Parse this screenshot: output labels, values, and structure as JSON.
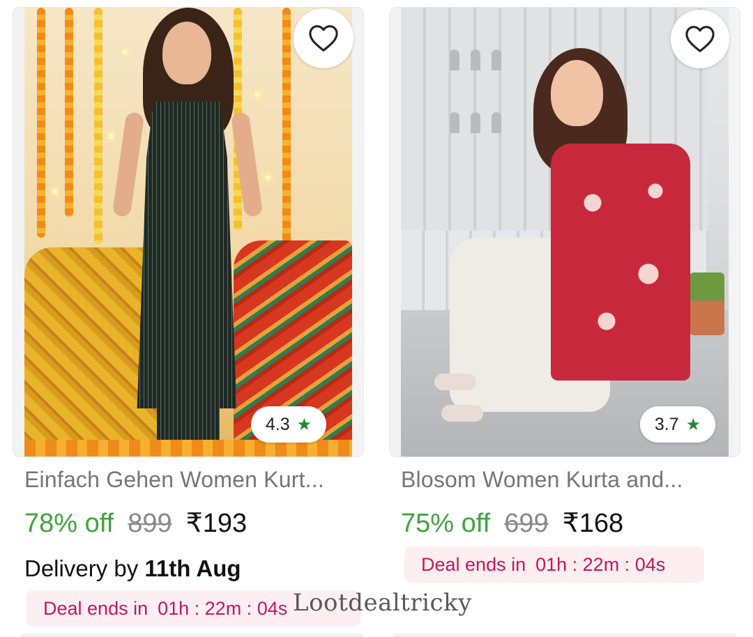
{
  "products": [
    {
      "title": "Einfach Gehen Women Kurt...",
      "rating": "4.3",
      "discount": "78% off",
      "mrp": "899",
      "price": "₹193",
      "delivery_prefix": "Delivery by",
      "delivery_date": "11th Aug",
      "deal_label": "Deal ends in",
      "deal_time": "01h : 22m : 04s",
      "wishlist_icon": "heart-outline-icon",
      "rating_icon": "star-icon"
    },
    {
      "title": "Blosom Women Kurta and...",
      "rating": "3.7",
      "discount": "75% off",
      "mrp": "699",
      "price": "₹168",
      "deal_label": "Deal ends in",
      "deal_time": "01h : 22m : 04s",
      "wishlist_icon": "heart-outline-icon",
      "rating_icon": "star-icon"
    }
  ],
  "watermark": "Lootdealtricky",
  "colors": {
    "discount": "#3fa33e",
    "star": "#1f8a34",
    "deal_text": "#c2185b",
    "deal_bg": "#fdeef1"
  }
}
